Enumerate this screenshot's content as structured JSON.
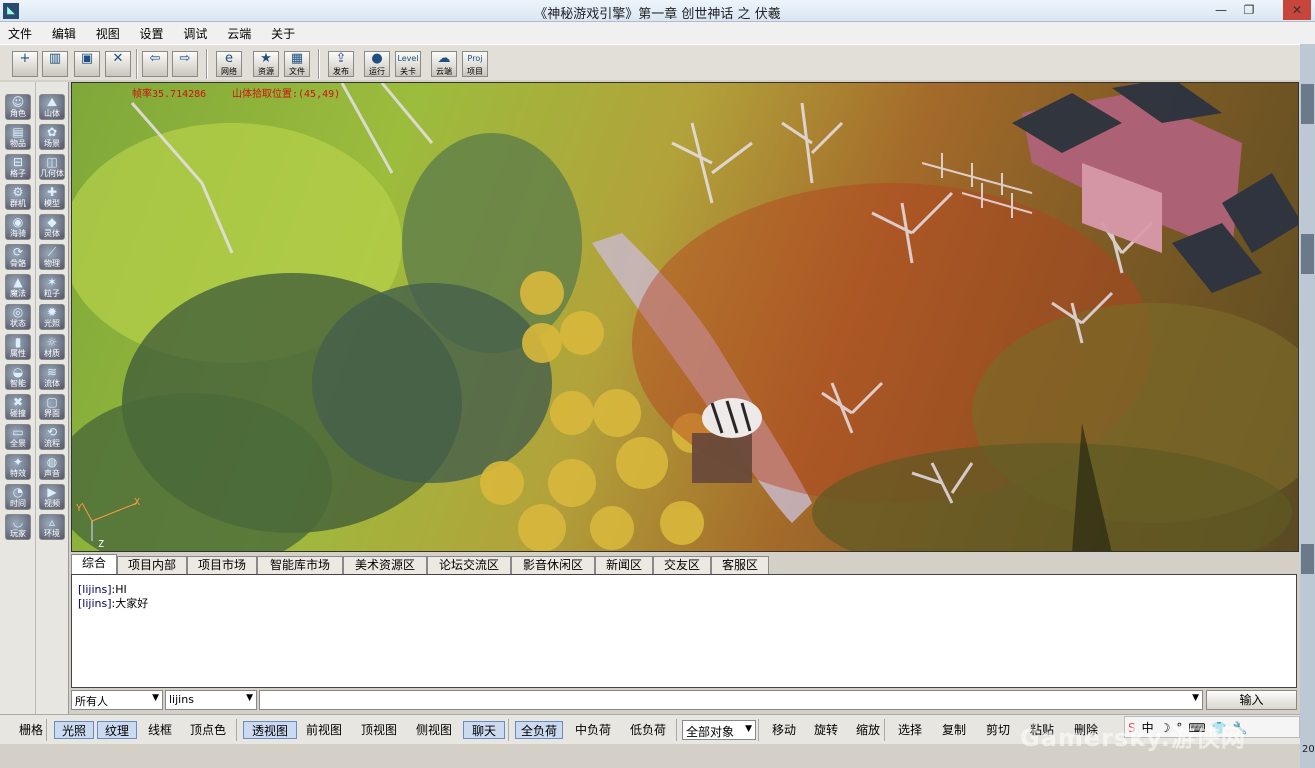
{
  "window": {
    "title": "《神秘游戏引擎》第一章 创世神话 之 伏羲",
    "min_label": "—",
    "max_label": "❐",
    "close_label": "✕"
  },
  "menu": [
    "文件",
    "编辑",
    "视图",
    "设置",
    "调试",
    "云端",
    "关于"
  ],
  "toolbar": {
    "new": {
      "glyph": "+",
      "label": ""
    },
    "open": {
      "glyph": "▥",
      "label": ""
    },
    "save": {
      "glyph": "▣",
      "label": ""
    },
    "close": {
      "glyph": "✕",
      "label": ""
    },
    "back": {
      "glyph": "⇦",
      "label": ""
    },
    "forward": {
      "glyph": "⇨",
      "label": ""
    },
    "network": {
      "glyph": "e",
      "label": "网络"
    },
    "resource": {
      "glyph": "★",
      "label": "资源"
    },
    "file": {
      "glyph": "▦",
      "label": "文件"
    },
    "publish": {
      "glyph": "⇪",
      "label": "发布"
    },
    "run": {
      "glyph": "●",
      "label": "运行"
    },
    "level": {
      "glyph": "Level",
      "label": "关卡"
    },
    "cloud": {
      "glyph": "☁",
      "label": "云端"
    },
    "project": {
      "glyph": "Proj",
      "label": "项目"
    }
  },
  "left_panel": {
    "col1": [
      {
        "glyph": "☺",
        "label": "角色"
      },
      {
        "glyph": "▤",
        "label": "物品"
      },
      {
        "glyph": "⊟",
        "label": "格子"
      },
      {
        "glyph": "⚙",
        "label": "群机"
      },
      {
        "glyph": "◉",
        "label": "海骑"
      },
      {
        "glyph": "⟳",
        "label": "骨骼"
      },
      {
        "glyph": "▲",
        "label": "魔法"
      },
      {
        "glyph": "◎",
        "label": "状态"
      },
      {
        "glyph": "▮",
        "label": "属性"
      },
      {
        "glyph": "◒",
        "label": "智能"
      },
      {
        "glyph": "✖",
        "label": "碰撞"
      },
      {
        "glyph": "▭",
        "label": "全景"
      },
      {
        "glyph": "✦",
        "label": "特效"
      },
      {
        "glyph": "◔",
        "label": "时间"
      },
      {
        "glyph": "◡",
        "label": "玩家"
      }
    ],
    "col2": [
      {
        "glyph": "⛰",
        "label": "山体"
      },
      {
        "glyph": "✿",
        "label": "场景"
      },
      {
        "glyph": "◫",
        "label": "几何体"
      },
      {
        "glyph": "✚",
        "label": "模型"
      },
      {
        "glyph": "◆",
        "label": "灵体"
      },
      {
        "glyph": "⟋",
        "label": "物理"
      },
      {
        "glyph": "✶",
        "label": "粒子"
      },
      {
        "glyph": "✹",
        "label": "光照"
      },
      {
        "glyph": "☼",
        "label": "材质"
      },
      {
        "glyph": "≋",
        "label": "流体"
      },
      {
        "glyph": "▢",
        "label": "界面"
      },
      {
        "glyph": "⟲",
        "label": "流程"
      },
      {
        "glyph": "◍",
        "label": "声音"
      },
      {
        "glyph": "▶",
        "label": "视频"
      },
      {
        "glyph": "▵",
        "label": "环境"
      }
    ]
  },
  "viewport": {
    "hud_left": "帧率35.714286",
    "hud_right": "山体拾取位置:(45,49)",
    "axis_x": "X",
    "axis_y": "Y",
    "axis_z": "Z"
  },
  "tabs": [
    "综合",
    "项目内部",
    "项目市场",
    "智能库市场",
    "美术资源区",
    "论坛交流区",
    "影音休闲区",
    "新闻区",
    "交友区",
    "客服区"
  ],
  "chat": {
    "lines": [
      {
        "name": "[lijins]",
        "text": ":HI"
      },
      {
        "name": "[lijins]",
        "text": ":大家好"
      }
    ]
  },
  "input_row": {
    "recipient": "所有人",
    "user": "lijins",
    "message": "",
    "send_label": "输入"
  },
  "bottom_bar": {
    "items": [
      {
        "label": "栅格",
        "on": false
      },
      {
        "label": "光照",
        "on": true
      },
      {
        "label": "纹理",
        "on": true
      },
      {
        "label": "线框",
        "on": false
      },
      {
        "label": "顶点色",
        "on": false
      },
      {
        "label": "透视图",
        "on": true
      },
      {
        "label": "前视图",
        "on": false
      },
      {
        "label": "顶视图",
        "on": false
      },
      {
        "label": "侧视图",
        "on": false
      },
      {
        "label": "聊天",
        "on": true
      },
      {
        "label": "全负荷",
        "on": true
      },
      {
        "label": "中负荷",
        "on": false
      },
      {
        "label": "低负荷",
        "on": false
      },
      {
        "label": "移动",
        "on": false
      },
      {
        "label": "旋转",
        "on": false
      },
      {
        "label": "缩放",
        "on": false
      },
      {
        "label": "选择",
        "on": false
      },
      {
        "label": "复制",
        "on": false
      },
      {
        "label": "剪切",
        "on": false
      },
      {
        "label": "粘贴",
        "on": false
      },
      {
        "label": "删除",
        "on": false
      }
    ],
    "object_filter": "全部对象"
  },
  "ime": [
    "S",
    "中",
    "☽",
    "°",
    "⌨",
    "👕",
    "🔧"
  ],
  "watermark": "Gamersky.游侠网",
  "clock": "20",
  "colors": {
    "toggle_on_bg": "#cbdaf0",
    "hud_text": "#d01010",
    "close_button": "#c7463c"
  }
}
